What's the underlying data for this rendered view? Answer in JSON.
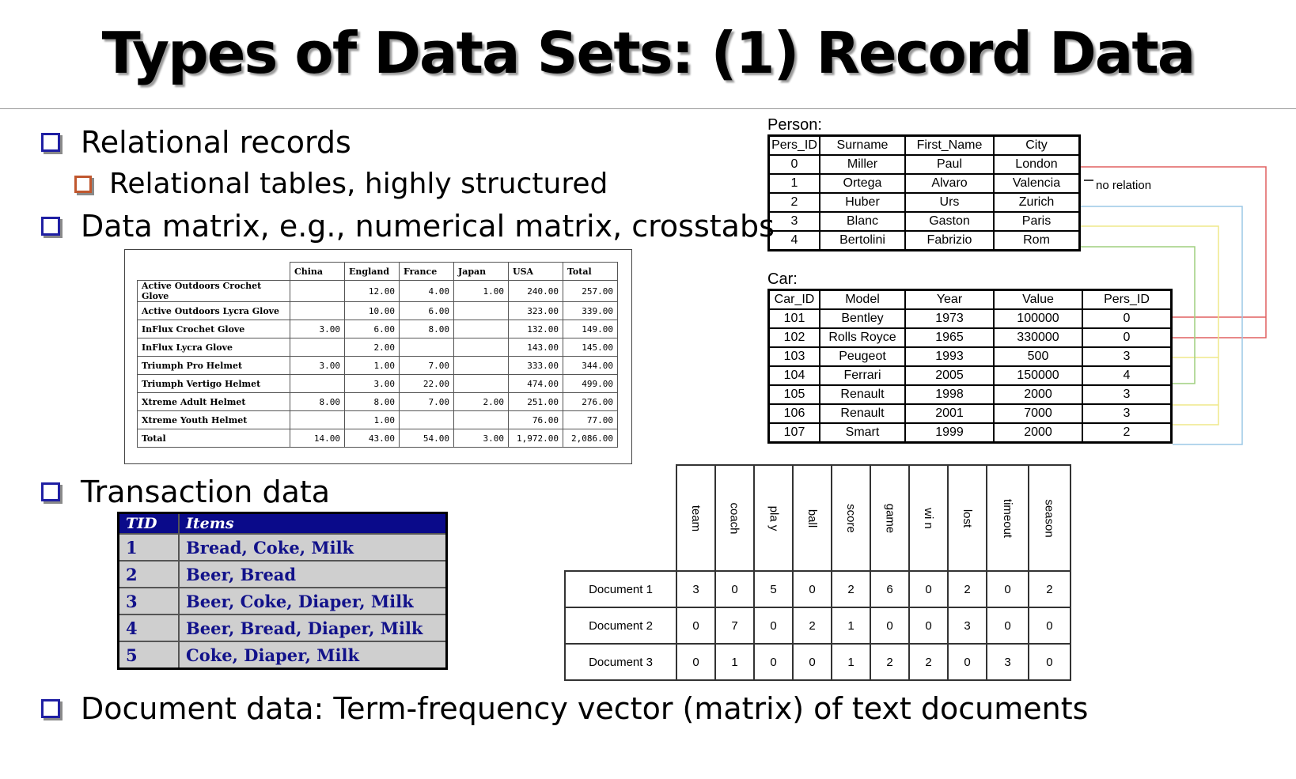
{
  "slide": {
    "title": "Types of Data Sets: (1) Record Data",
    "bullets": {
      "relational": "Relational records",
      "relational_sub": "Relational tables, highly structured",
      "matrix": "Data matrix, e.g., numerical matrix, crosstabs",
      "transaction": "Transaction data",
      "document": "Document data: Term-frequency vector (matrix) of text documents"
    }
  },
  "crosstab": {
    "columns": [
      "China",
      "England",
      "France",
      "Japan",
      "USA",
      "Total"
    ],
    "rows": [
      {
        "name": "Active Outdoors Crochet Glove",
        "values": [
          "",
          "12.00",
          "4.00",
          "1.00",
          "240.00",
          "257.00"
        ]
      },
      {
        "name": "Active Outdoors Lycra Glove",
        "values": [
          "",
          "10.00",
          "6.00",
          "",
          "323.00",
          "339.00"
        ]
      },
      {
        "name": "InFlux Crochet Glove",
        "values": [
          "3.00",
          "6.00",
          "8.00",
          "",
          "132.00",
          "149.00"
        ]
      },
      {
        "name": "InFlux Lycra Glove",
        "values": [
          "",
          "2.00",
          "",
          "",
          "143.00",
          "145.00"
        ]
      },
      {
        "name": "Triumph Pro Helmet",
        "values": [
          "3.00",
          "1.00",
          "7.00",
          "",
          "333.00",
          "344.00"
        ]
      },
      {
        "name": "Triumph Vertigo Helmet",
        "values": [
          "",
          "3.00",
          "22.00",
          "",
          "474.00",
          "499.00"
        ]
      },
      {
        "name": "Xtreme Adult Helmet",
        "values": [
          "8.00",
          "8.00",
          "7.00",
          "2.00",
          "251.00",
          "276.00"
        ]
      },
      {
        "name": "Xtreme Youth Helmet",
        "values": [
          "",
          "1.00",
          "",
          "",
          "76.00",
          "77.00"
        ]
      },
      {
        "name": "Total",
        "values": [
          "14.00",
          "43.00",
          "54.00",
          "3.00",
          "1,972.00",
          "2,086.00"
        ]
      }
    ]
  },
  "person": {
    "label": "Person:",
    "columns": [
      "Pers_ID",
      "Surname",
      "First_Name",
      "City"
    ],
    "rows": [
      [
        "0",
        "Miller",
        "Paul",
        "London"
      ],
      [
        "1",
        "Ortega",
        "Alvaro",
        "Valencia"
      ],
      [
        "2",
        "Huber",
        "Urs",
        "Zurich"
      ],
      [
        "3",
        "Blanc",
        "Gaston",
        "Paris"
      ],
      [
        "4",
        "Bertolini",
        "Fabrizio",
        "Rom"
      ]
    ],
    "annotation": "no relation"
  },
  "car": {
    "label": "Car:",
    "columns": [
      "Car_ID",
      "Model",
      "Year",
      "Value",
      "Pers_ID"
    ],
    "rows": [
      [
        "101",
        "Bentley",
        "1973",
        "100000",
        "0"
      ],
      [
        "102",
        "Rolls Royce",
        "1965",
        "330000",
        "0"
      ],
      [
        "103",
        "Peugeot",
        "1993",
        "500",
        "3"
      ],
      [
        "104",
        "Ferrari",
        "2005",
        "150000",
        "4"
      ],
      [
        "105",
        "Renault",
        "1998",
        "2000",
        "3"
      ],
      [
        "106",
        "Renault",
        "2001",
        "7000",
        "3"
      ],
      [
        "107",
        "Smart",
        "1999",
        "2000",
        "2"
      ]
    ],
    "link_colors": {
      "red": "#e06060",
      "blue": "#9cc8e6",
      "yellow": "#efe88a",
      "green": "#9fcf7f"
    }
  },
  "transactions": {
    "columns": [
      "TID",
      "Items"
    ],
    "rows": [
      [
        "1",
        "Bread, Coke, Milk"
      ],
      [
        "2",
        "Beer, Bread"
      ],
      [
        "3",
        "Beer, Coke, Diaper, Milk"
      ],
      [
        "4",
        "Beer, Bread, Diaper, Milk"
      ],
      [
        "5",
        "Coke, Diaper, Milk"
      ]
    ]
  },
  "documents": {
    "terms": [
      "team",
      "coach",
      "pla\ny",
      "ball",
      "score",
      "game",
      "wi\nn",
      "lost",
      "timeout",
      "season"
    ],
    "rows": [
      {
        "name": "Document 1",
        "values": [
          "3",
          "0",
          "5",
          "0",
          "2",
          "6",
          "0",
          "2",
          "0",
          "2"
        ]
      },
      {
        "name": "Document 2",
        "values": [
          "0",
          "7",
          "0",
          "2",
          "1",
          "0",
          "0",
          "3",
          "0",
          "0"
        ]
      },
      {
        "name": "Document 3",
        "values": [
          "0",
          "1",
          "0",
          "0",
          "1",
          "2",
          "2",
          "0",
          "3",
          "0"
        ]
      }
    ]
  }
}
